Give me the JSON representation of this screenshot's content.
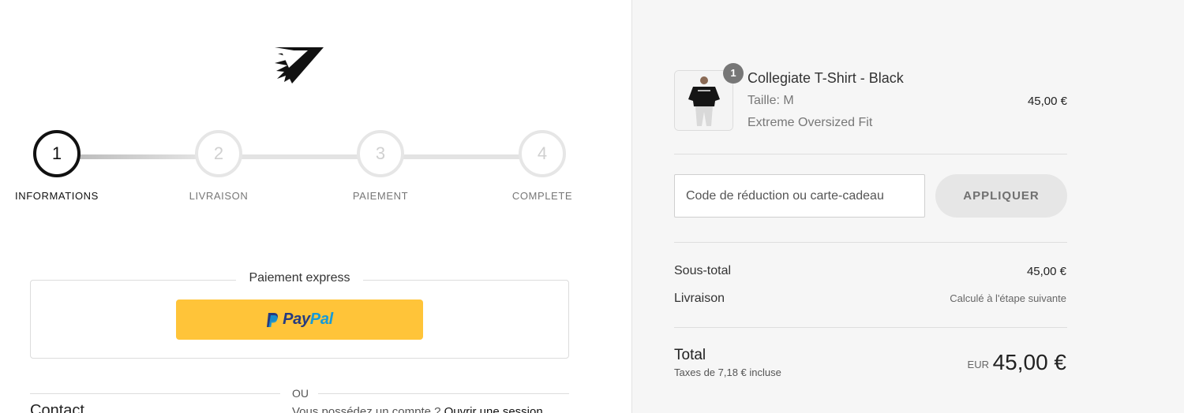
{
  "progress": {
    "steps": [
      {
        "number": "1",
        "label": "INFORMATIONS",
        "state": "active"
      },
      {
        "number": "2",
        "label": "LIVRAISON",
        "state": "upcoming"
      },
      {
        "number": "3",
        "label": "PAIEMENT",
        "state": "upcoming"
      },
      {
        "number": "4",
        "label": "COMPLETE",
        "state": "upcoming"
      }
    ]
  },
  "express": {
    "title": "Paiement express",
    "paypal": {
      "word_pay": "Pay",
      "word_pal": "Pal",
      "bg_color": "#ffc439"
    }
  },
  "separator": {
    "text": "OU"
  },
  "contact": {
    "title": "Contact",
    "account_prompt": "Vous possédez un compte ?",
    "login_link": "Ouvrir une session"
  },
  "summary": {
    "product": {
      "quantity": "1",
      "name": "Collegiate T-Shirt - Black",
      "size": "Taille: M",
      "fit": "Extreme Oversized Fit",
      "price": "45,00 €"
    },
    "discount": {
      "placeholder": "Code de réduction ou carte-cadeau",
      "apply_label": "APPLIQUER"
    },
    "subtotal": {
      "label": "Sous-total",
      "value": "45,00 €"
    },
    "shipping": {
      "label": "Livraison",
      "value": "Calculé à l'étape suivante"
    },
    "total": {
      "label": "Total",
      "tax_note": "Taxes de 7,18 € incluse",
      "currency": "EUR",
      "amount": "45,00 €"
    }
  }
}
